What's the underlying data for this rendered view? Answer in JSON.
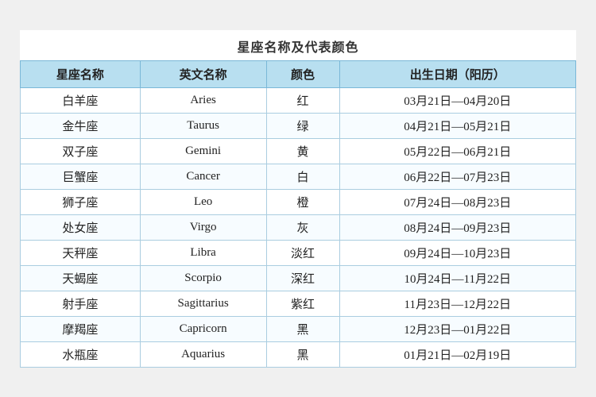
{
  "title": "星座名称及代表颜色",
  "table": {
    "headers": [
      "星座名称",
      "英文名称",
      "颜色",
      "出生日期（阳历）"
    ],
    "rows": [
      {
        "chinese": "白羊座",
        "english": "Aries",
        "color": "红",
        "date": "03月21日—04月20日"
      },
      {
        "chinese": "金牛座",
        "english": "Taurus",
        "color": "绿",
        "date": "04月21日—05月21日"
      },
      {
        "chinese": "双子座",
        "english": "Gemini",
        "color": "黄",
        "date": "05月22日—06月21日"
      },
      {
        "chinese": "巨蟹座",
        "english": "Cancer",
        "color": "白",
        "date": "06月22日—07月23日"
      },
      {
        "chinese": "狮子座",
        "english": "Leo",
        "color": "橙",
        "date": "07月24日—08月23日"
      },
      {
        "chinese": "处女座",
        "english": "Virgo",
        "color": "灰",
        "date": "08月24日—09月23日"
      },
      {
        "chinese": "天秤座",
        "english": "Libra",
        "color": "淡红",
        "date": "09月24日—10月23日"
      },
      {
        "chinese": "天蝎座",
        "english": "Scorpio",
        "color": "深红",
        "date": "10月24日—11月22日"
      },
      {
        "chinese": "射手座",
        "english": "Sagittarius",
        "color": "紫红",
        "date": "11月23日—12月22日"
      },
      {
        "chinese": "摩羯座",
        "english": "Capricorn",
        "color": "黑",
        "date": "12月23日—01月22日"
      },
      {
        "chinese": "水瓶座",
        "english": "Aquarius",
        "color": "黑",
        "date": "01月21日—02月19日"
      }
    ]
  }
}
